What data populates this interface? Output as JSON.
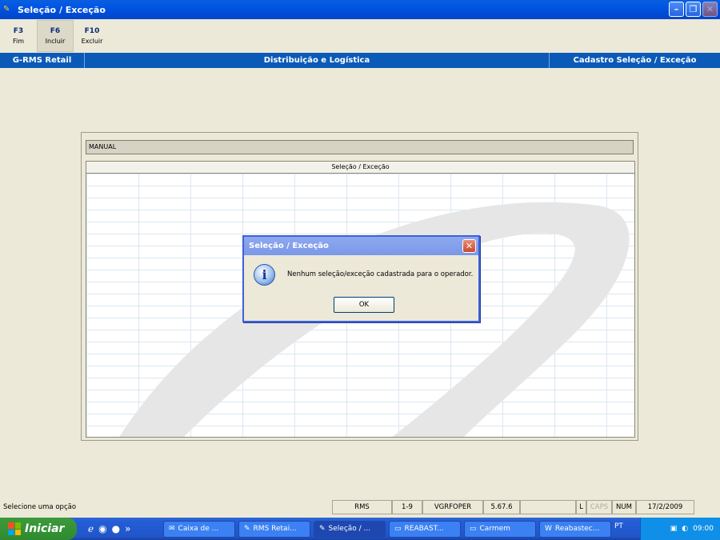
{
  "window": {
    "title": "Seleção / Exceção"
  },
  "toolbar": [
    {
      "key": "F3",
      "label": "Fim"
    },
    {
      "key": "F6",
      "label": "Incluir"
    },
    {
      "key": "F10",
      "label": "Excluir"
    }
  ],
  "header": {
    "left": "G-RMS Retail",
    "center": "Distribuição e Logística",
    "right": "Cadastro Seleção / Exceção"
  },
  "panel": {
    "manual_label": "MANUAL",
    "grid_header": "Seleção / Exceção"
  },
  "dialog": {
    "title": "Seleção / Exceção",
    "message": "Nenhum seleção/exceção cadastrada para o operador.",
    "ok_label": "OK"
  },
  "statusbar": {
    "message": "Selecione uma opção",
    "system": "RMS",
    "range": "1-9",
    "program": "VGRFOPER",
    "version": "5.67.6",
    "ind_l": "L",
    "ind_caps": "CAPS",
    "ind_num": "NUM",
    "date": "17/2/2009"
  },
  "taskbar": {
    "start_label": "Iniciar",
    "tasks": [
      "Caixa de ...",
      "RMS Retai...",
      "Seleção / ...",
      "REABAST...",
      "Carmem",
      "Reabastec..."
    ],
    "language": "PT",
    "clock": "09:00"
  }
}
